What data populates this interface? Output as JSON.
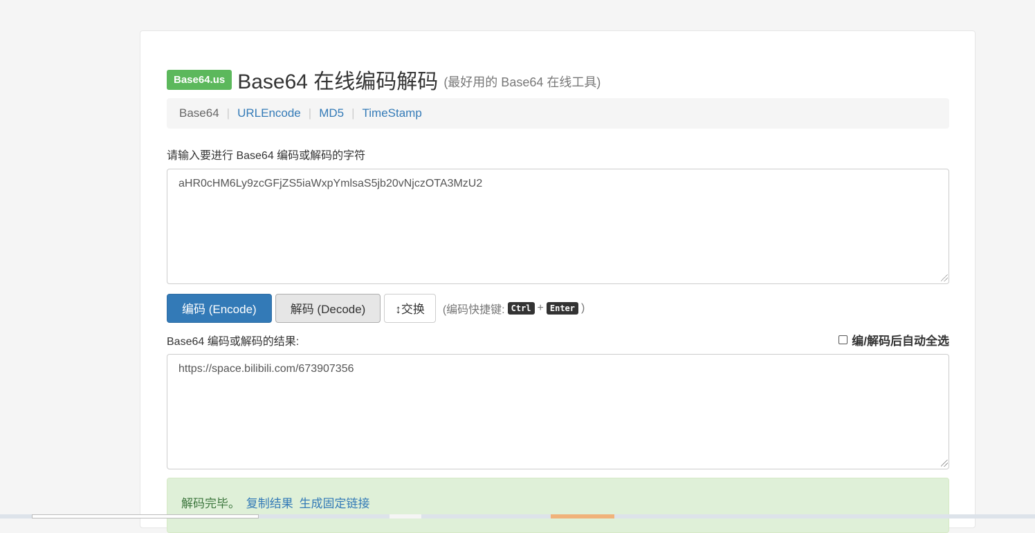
{
  "header": {
    "brand": "Base64.us",
    "title": "Base64 在线编码解码",
    "subtitle": "(最好用的 Base64 在线工具)"
  },
  "nav": {
    "items": [
      {
        "label": "Base64",
        "active": true
      },
      {
        "label": "URLEncode",
        "active": false
      },
      {
        "label": "MD5",
        "active": false
      },
      {
        "label": "TimeStamp",
        "active": false
      }
    ],
    "separator": "|"
  },
  "input": {
    "label": "请输入要进行 Base64 编码或解码的字符",
    "value": "aHR0cHM6Ly9zcGFjZS5iaWxpYmlsaS5jb20vNjczOTA3MzU2"
  },
  "buttons": {
    "encode": "编码 (Encode)",
    "decode": "解码 (Decode)",
    "swap": "↕交换"
  },
  "shortcut": {
    "prefix": "(编码快捷键:",
    "key1": "Ctrl",
    "plus": "+",
    "key2": "Enter",
    "suffix": ")"
  },
  "result": {
    "label": "Base64 编码或解码的结果:",
    "auto_select_label": "编/解码后自动全选",
    "auto_select_checked": false,
    "value": "https://space.bilibili.com/673907356"
  },
  "status": {
    "message": "解码完毕。",
    "copy_link": "复制结果",
    "permalink": "生成固定链接"
  },
  "colors": {
    "brand": "#5cb85c",
    "primary": "#337ab7",
    "success_bg": "#dff0d8"
  }
}
